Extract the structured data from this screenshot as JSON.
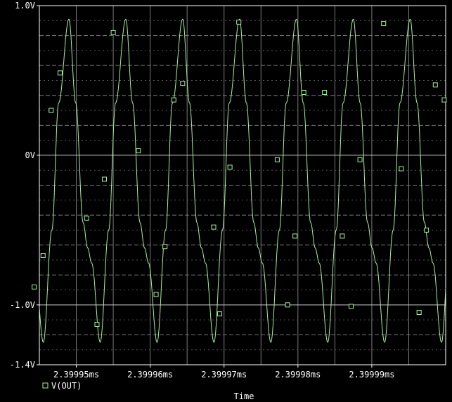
{
  "chart_data": {
    "type": "line",
    "xlabel": "Time",
    "x_tick_labels": [
      "2.39995ms",
      "2.39996ms",
      "2.39997ms",
      "2.39998ms",
      "2.39999ms"
    ],
    "x_ticks_ms": [
      2.39995,
      2.39996,
      2.39997,
      2.39998,
      2.39999
    ],
    "xlim_ms": [
      2.399945,
      2.4
    ],
    "y_tick_labels": [
      "1.0V",
      "0V",
      "-1.0V",
      "-1.4V"
    ],
    "y_ticks": [
      1.0,
      0.0,
      -1.0,
      -1.4
    ],
    "ylim": [
      -1.4,
      1.0
    ],
    "grid": true,
    "legend": "bottom-left",
    "series": [
      {
        "name": "V(OUT)",
        "color": "#a8f0a0",
        "marker": "square",
        "period_ms": 7.7e-06,
        "first_peak_ms": 2.399949,
        "peak_value": 0.91,
        "trough_value": -1.25,
        "marker_points": [
          [
            2.3999443,
            -0.88
          ],
          [
            2.3999455,
            -0.67
          ],
          [
            2.3999466,
            0.3
          ],
          [
            2.3999478,
            0.55
          ],
          [
            2.3999514,
            -0.42
          ],
          [
            2.3999528,
            -1.13
          ],
          [
            2.3999538,
            -0.16
          ],
          [
            2.399955,
            0.82
          ],
          [
            2.3999584,
            0.03
          ],
          [
            2.3999608,
            -0.93
          ],
          [
            2.399962,
            -0.61
          ],
          [
            2.3999632,
            0.37
          ],
          [
            2.3999644,
            0.48
          ],
          [
            2.3999686,
            -0.48
          ],
          [
            2.3999694,
            -1.06
          ],
          [
            2.3999708,
            -0.08
          ],
          [
            2.399972,
            0.89
          ],
          [
            2.3999772,
            -0.03
          ],
          [
            2.3999786,
            -1.0
          ],
          [
            2.3999796,
            -0.54
          ],
          [
            2.3999808,
            0.42
          ],
          [
            2.3999836,
            0.42
          ],
          [
            2.399986,
            -0.54
          ],
          [
            2.3999872,
            -1.01
          ],
          [
            2.3999884,
            -0.03
          ],
          [
            2.3999916,
            0.88
          ],
          [
            2.399994,
            -0.09
          ],
          [
            2.3999964,
            -1.05
          ],
          [
            2.3999974,
            -0.5
          ],
          [
            2.3999986,
            0.47
          ],
          [
            2.3999998,
            0.37
          ]
        ]
      }
    ]
  }
}
